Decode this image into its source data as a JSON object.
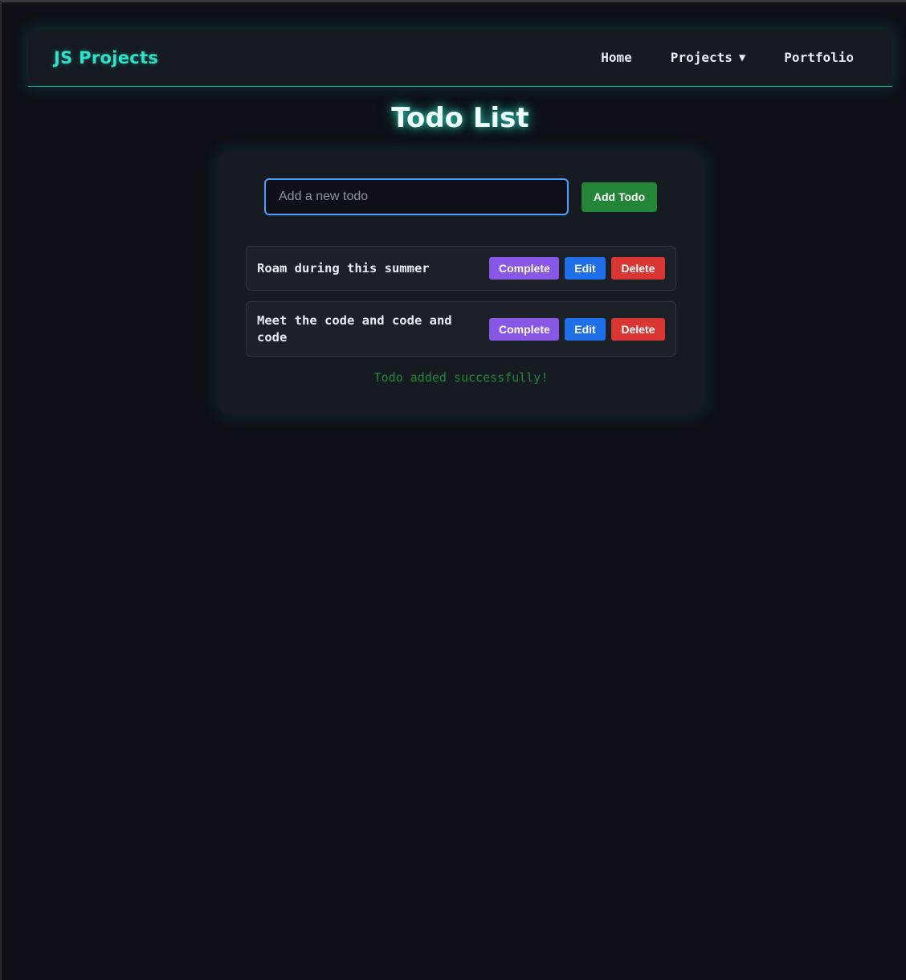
{
  "navbar": {
    "brand": "JS Projects",
    "links": [
      {
        "label": "Home"
      },
      {
        "label": "Projects",
        "caret": "▼"
      },
      {
        "label": "Portfolio"
      }
    ]
  },
  "page": {
    "title": "Todo List"
  },
  "form": {
    "input_value": "",
    "input_placeholder": "Add a new todo",
    "add_button_label": "Add Todo"
  },
  "todos": [
    {
      "text": "Roam during this summer",
      "complete_label": "Complete",
      "edit_label": "Edit",
      "delete_label": "Delete"
    },
    {
      "text": "Meet the code and code and code",
      "complete_label": "Complete",
      "edit_label": "Edit",
      "delete_label": "Delete"
    }
  ],
  "status": {
    "message": "Todo added successfully!"
  },
  "colors": {
    "background": "#0d1117",
    "accent": "#2de2c8",
    "complete": "#8957e5",
    "edit": "#1f6feb",
    "delete": "#da3633",
    "add": "#238636"
  }
}
